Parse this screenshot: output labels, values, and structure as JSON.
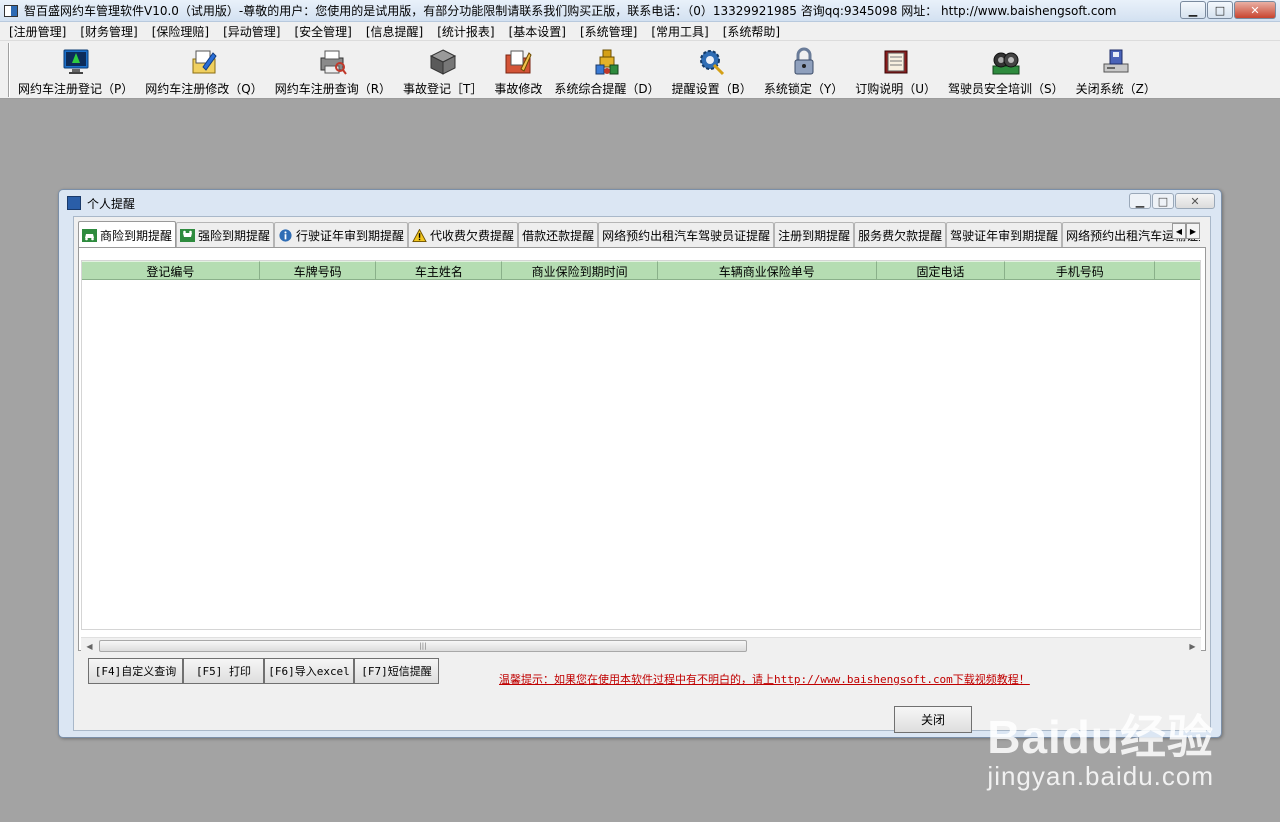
{
  "window": {
    "title": "智百盛网约车管理软件V10.0（试用版）-尊敬的用户：您使用的是试用版，有部分功能限制请联系我们购买正版，联系电话：（0）13329921985 咨询qq:9345098   网址： http://www.baishengsoft.com",
    "min_label": "▁",
    "max_label": "□",
    "close_label": "✕"
  },
  "menu": [
    "[注册管理]",
    "[财务管理]",
    "[保险理赔]",
    "[异动管理]",
    "[安全管理]",
    "[信息提醒]",
    "[统计报表]",
    "[基本设置]",
    "[系统管理]",
    "[常用工具]",
    "[系统帮助]"
  ],
  "toolbar": [
    {
      "label": "网约车注册登记（P）",
      "icon": "monitor-icon",
      "color": "#1b6fc9"
    },
    {
      "label": "网约车注册修改（Q）",
      "icon": "edit-document-icon",
      "color": "#2a6ed8"
    },
    {
      "label": "网约车注册查询（R）",
      "icon": "printer-search-icon",
      "color": "#6b6b6b"
    },
    {
      "label": "事故登记［T］",
      "icon": "cube-icon",
      "color": "#555555"
    },
    {
      "label": "事故修改",
      "icon": "folder-edit-icon",
      "color": "#c0392b"
    },
    {
      "label": "系统综合提醒（D）",
      "icon": "robot-icon",
      "color": "#d4a017"
    },
    {
      "label": "提醒设置（B）",
      "icon": "gear-icon",
      "color": "#2f6db5"
    },
    {
      "label": "系统锁定（Y）",
      "icon": "lock-icon",
      "color": "#6a7c99"
    },
    {
      "label": "订购说明（U）",
      "icon": "book-icon",
      "color": "#8b1a1a"
    },
    {
      "label": "驾驶员安全培训（S）",
      "icon": "tires-icon",
      "color": "#2e8b3e"
    },
    {
      "label": "关闭系统（Z）",
      "icon": "shutdown-icon",
      "color": "#4a63b8"
    }
  ],
  "child": {
    "title": "个人提醒",
    "tabs": [
      {
        "label": "商险到期提醒",
        "icon": "car-green-icon"
      },
      {
        "label": "强险到期提醒",
        "icon": "car-green-icon"
      },
      {
        "label": "行驶证年审到期提醒",
        "icon": "info-icon"
      },
      {
        "label": "代收费欠费提醒",
        "icon": "warning-icon"
      },
      {
        "label": "借款还款提醒",
        "icon": ""
      },
      {
        "label": "网络预约出租汽车驾驶员证提醒",
        "icon": ""
      },
      {
        "label": "注册到期提醒",
        "icon": ""
      },
      {
        "label": "服务费欠款提醒",
        "icon": ""
      },
      {
        "label": "驾驶证年审到期提醒",
        "icon": ""
      },
      {
        "label": "网络预约出租汽车运输证提醒",
        "icon": ""
      }
    ],
    "tab_scroll_left": "◀",
    "tab_scroll_right": "▶",
    "columns": [
      "登记编号",
      "车牌号码",
      "车主姓名",
      "商业保险到期时间",
      "车辆商业保险单号",
      "固定电话",
      "手机号码",
      ""
    ],
    "scroll_left": "◀",
    "scroll_right": "▶",
    "scroll_grip": "|||",
    "buttons": [
      "[F4]自定义查询",
      "[F5] 打印",
      "[F6]导入excel",
      "[F7]短信提醒"
    ],
    "tip": "温馨提示：如果您在使用本软件过程中有不明白的，请上http://www.baishengsoft.com下载视频教程！",
    "close_label": "关闭"
  },
  "watermark": {
    "logo": "Baidu经验",
    "url": "jingyan.baidu.com"
  }
}
